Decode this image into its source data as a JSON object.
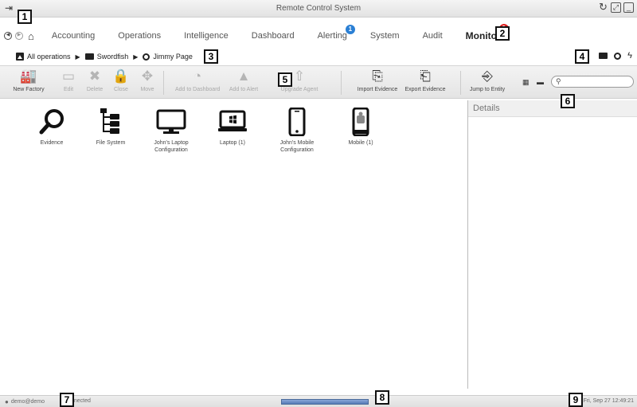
{
  "window": {
    "title": "Remote Control System"
  },
  "nav": {
    "menu": [
      {
        "label": "Accounting",
        "badge": ""
      },
      {
        "label": "Operations",
        "badge": ""
      },
      {
        "label": "Intelligence",
        "badge": ""
      },
      {
        "label": "Dashboard",
        "badge": ""
      },
      {
        "label": "Alerting",
        "badge": "1",
        "badge_color": "#2a7fd4"
      },
      {
        "label": "System",
        "badge": ""
      },
      {
        "label": "Audit",
        "badge": ""
      },
      {
        "label": "Monitor",
        "badge": "2",
        "badge_color": "#e02020",
        "active": true
      }
    ]
  },
  "breadcrumbs": [
    {
      "label": "All operations",
      "icon": "operations-icon"
    },
    {
      "label": "Swordfish",
      "icon": "folder-icon"
    },
    {
      "label": "Jimmy Page",
      "icon": "target-icon"
    }
  ],
  "toolbar": {
    "buttons": [
      {
        "label": "New Factory",
        "icon": "factory-icon",
        "enabled": true
      },
      {
        "label": "Edit",
        "icon": "edit-icon",
        "enabled": false
      },
      {
        "label": "Delete",
        "icon": "delete-icon",
        "enabled": false
      },
      {
        "label": "Close",
        "icon": "lock-icon",
        "enabled": false
      },
      {
        "label": "Move",
        "icon": "move-icon",
        "enabled": false
      },
      {
        "label": "Add to Dashboard",
        "icon": "dashboard-icon",
        "enabled": false
      },
      {
        "label": "Add to Alert",
        "icon": "alert-icon",
        "enabled": false
      },
      {
        "label": "Upgrade Agent",
        "icon": "upgrade-icon",
        "enabled": false
      },
      {
        "label": "Import Evidence",
        "icon": "import-icon",
        "enabled": true
      },
      {
        "label": "Export Evidence",
        "icon": "export-icon",
        "enabled": true
      },
      {
        "label": "Jump to Entity",
        "icon": "jump-icon",
        "enabled": true
      }
    ],
    "search": {
      "value": "",
      "placeholder": ""
    }
  },
  "entities": [
    {
      "label": "Evidence",
      "icon": "magnifier-icon"
    },
    {
      "label": "File System",
      "icon": "filesystem-icon"
    },
    {
      "label": "John's Laptop Configuration",
      "icon": "monitor-icon"
    },
    {
      "label": "Laptop (1)",
      "icon": "laptop-windows-icon"
    },
    {
      "label": "John's Mobile Configuration",
      "icon": "mobile-icon"
    },
    {
      "label": "Mobile (1)",
      "icon": "mobile-android-icon"
    }
  ],
  "details": {
    "title": "Details"
  },
  "status": {
    "user": "demo@demo",
    "connection": "nnected",
    "progress": 1.0,
    "datetime": "Fri, Sep 27  12:49:21"
  },
  "callouts": [
    "1",
    "2",
    "3",
    "4",
    "5",
    "6",
    "7",
    "8",
    "9"
  ]
}
